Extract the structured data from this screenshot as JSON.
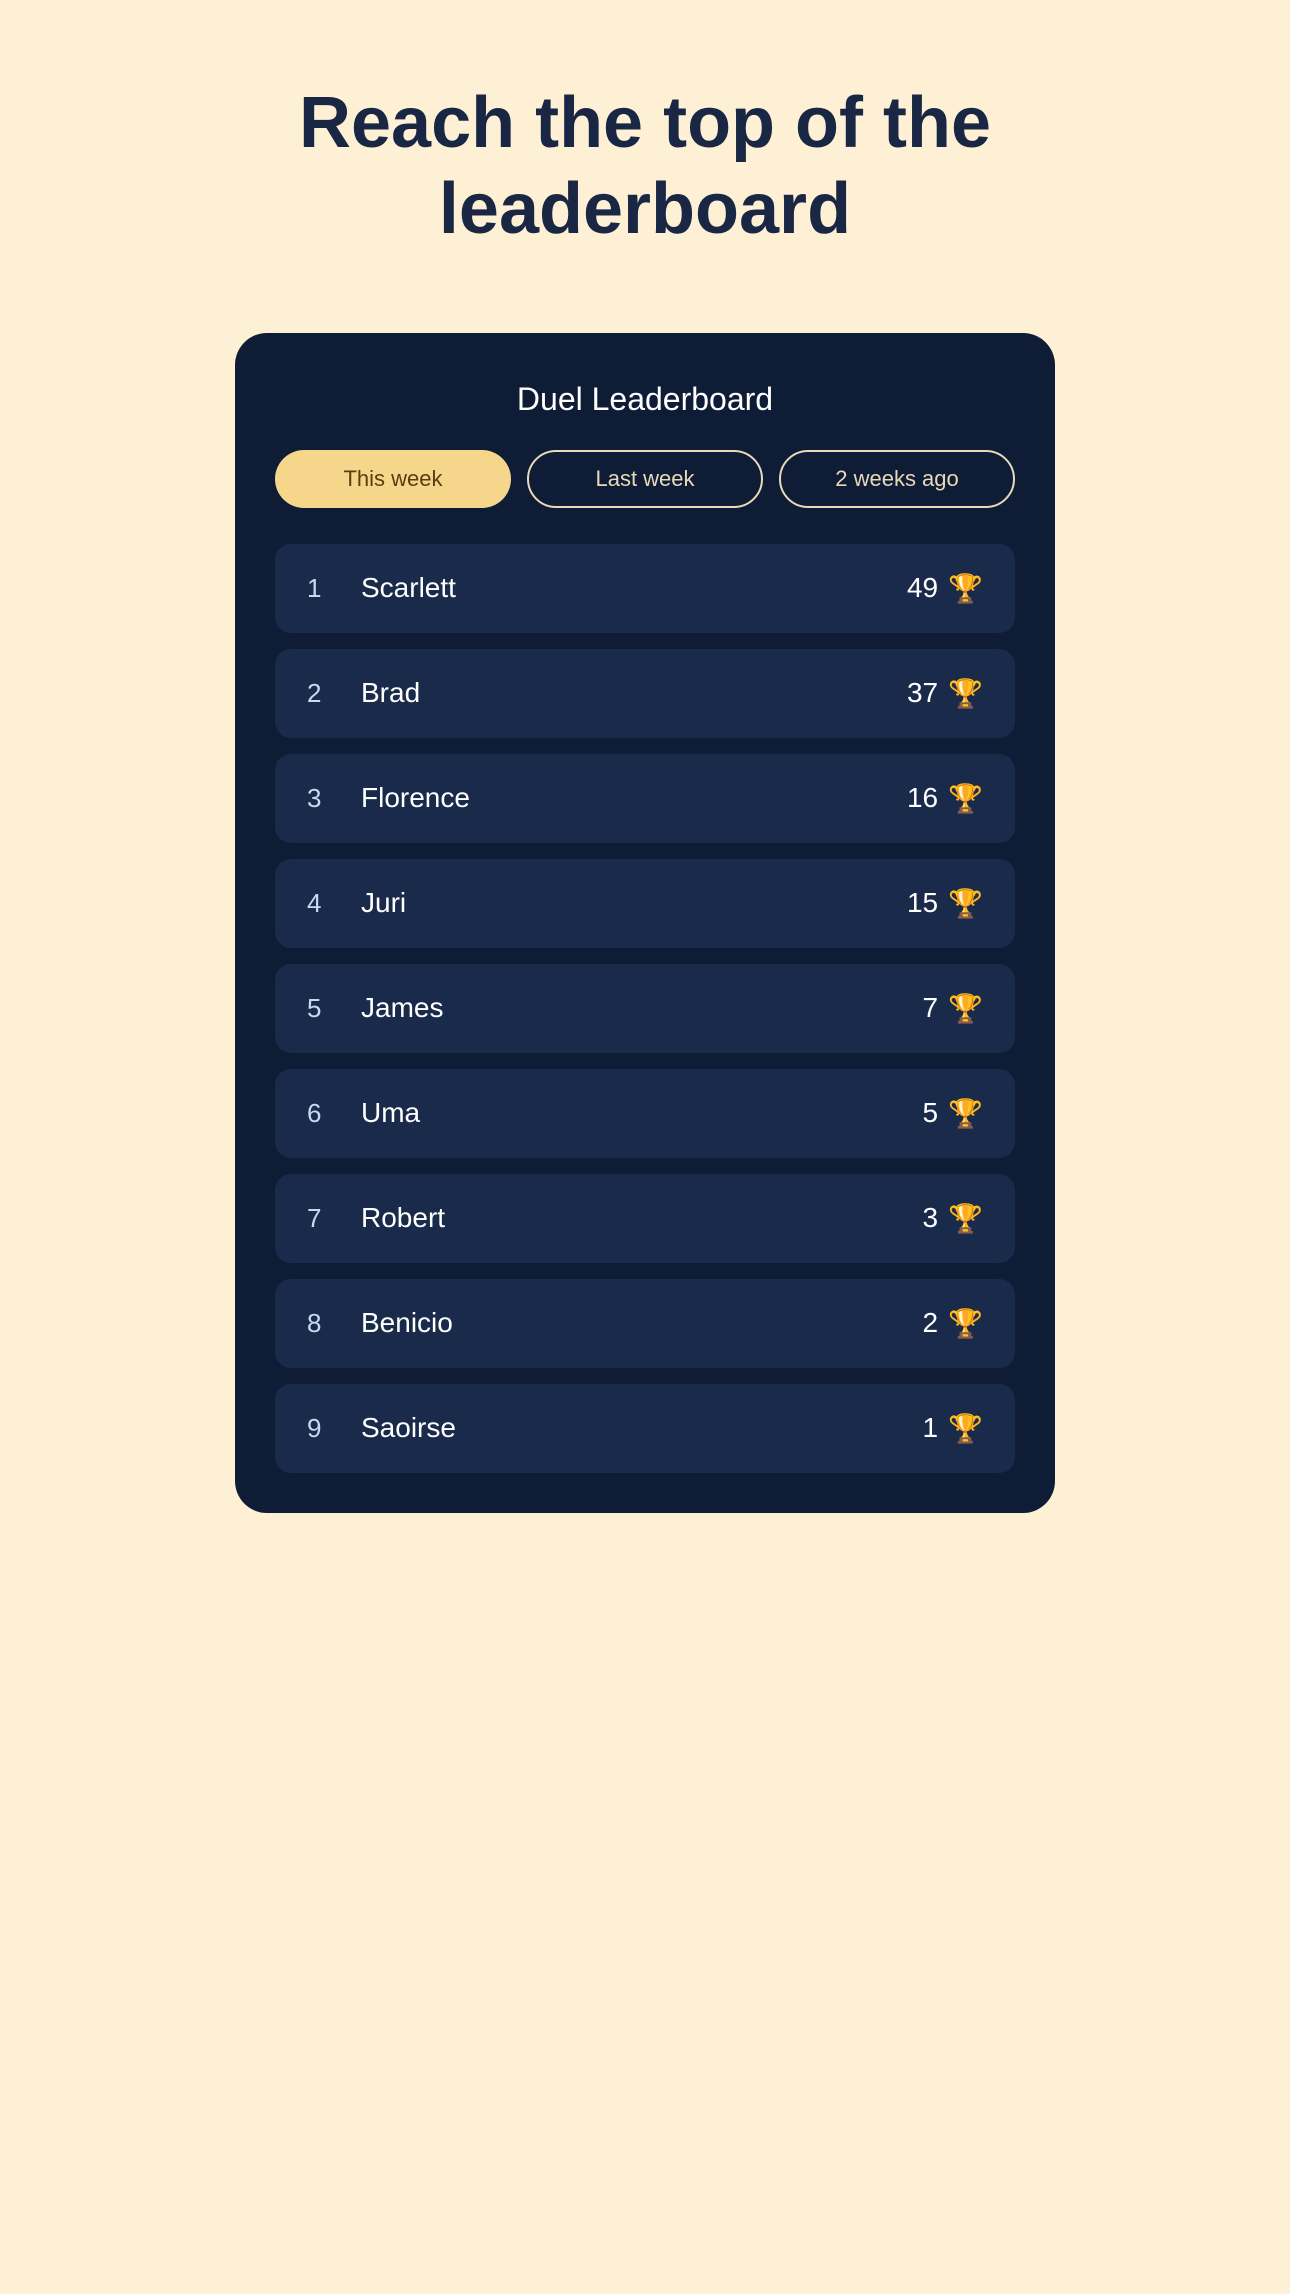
{
  "page": {
    "title_line1": "Reach the top of the",
    "title_line2": "leaderboard"
  },
  "card": {
    "title": "Duel Leaderboard"
  },
  "tabs": [
    {
      "id": "this-week",
      "label": "This week",
      "active": true
    },
    {
      "id": "last-week",
      "label": "Last week",
      "active": false
    },
    {
      "id": "two-weeks-ago",
      "label": "2 weeks ago",
      "active": false
    }
  ],
  "leaderboard": [
    {
      "rank": "1",
      "name": "Scarlett",
      "score": "49"
    },
    {
      "rank": "2",
      "name": "Brad",
      "score": "37"
    },
    {
      "rank": "3",
      "name": "Florence",
      "score": "16"
    },
    {
      "rank": "4",
      "name": "Juri",
      "score": "15"
    },
    {
      "rank": "5",
      "name": "James",
      "score": "7"
    },
    {
      "rank": "6",
      "name": "Uma",
      "score": "5"
    },
    {
      "rank": "7",
      "name": "Robert",
      "score": "3"
    },
    {
      "rank": "8",
      "name": "Benicio",
      "score": "2"
    },
    {
      "rank": "9",
      "name": "Saoirse",
      "score": "1"
    }
  ],
  "icons": {
    "trophy": "🏆"
  }
}
